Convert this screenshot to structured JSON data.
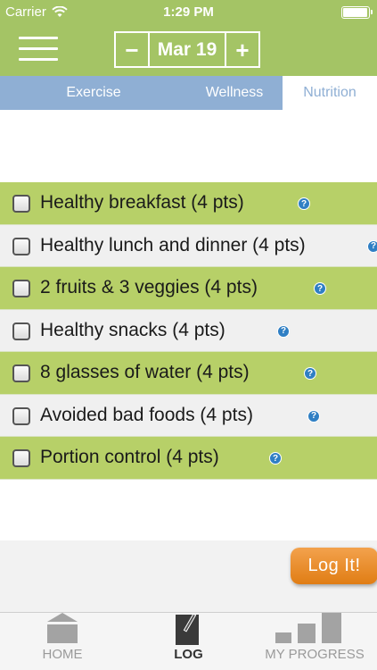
{
  "status_bar": {
    "carrier": "Carrier",
    "time": "1:29 PM",
    "battery_level": 0.95
  },
  "header": {
    "menu_icon": "hamburger-icon",
    "decrement_label": "−",
    "date": "Mar 19",
    "increment_label": "+"
  },
  "tabs": [
    {
      "label": "Exercise"
    },
    {
      "label": "Wellness"
    },
    {
      "label": "Nutrition",
      "selected": true
    }
  ],
  "items": [
    {
      "label": "Healthy breakfast (4 pts)",
      "checked": false
    },
    {
      "label": "Healthy lunch and dinner (4 pts)",
      "checked": false
    },
    {
      "label": "2 fruits & 3 veggies (4 pts)",
      "checked": false
    },
    {
      "label": "Healthy snacks (4 pts)",
      "checked": false
    },
    {
      "label": "8 glasses of water (4 pts)",
      "checked": false
    },
    {
      "label": "Avoided bad foods (4 pts)",
      "checked": false
    },
    {
      "label": "Portion control (4 pts)",
      "checked": false
    }
  ],
  "help_glyph": "?",
  "log_button": {
    "label": "Log It!"
  },
  "tabbar": [
    {
      "label": "HOME",
      "icon": "home-icon"
    },
    {
      "label": "LOG",
      "icon": "log-icon",
      "active": true
    },
    {
      "label": "MY PROGRESS",
      "icon": "progress-bars-icon"
    }
  ],
  "colors": {
    "header_green": "#a4c465",
    "row_green": "#b7d068",
    "tab_blue": "#8fafd4",
    "button_orange": "#e8892a",
    "help_blue": "#2f7fc4"
  }
}
